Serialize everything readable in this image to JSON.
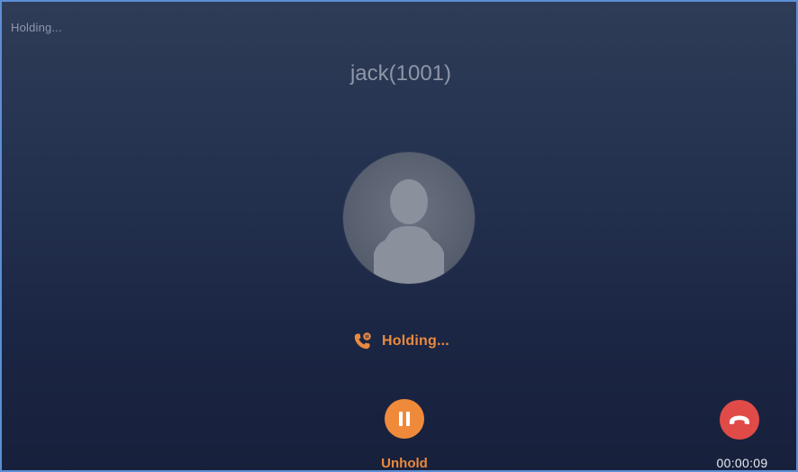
{
  "call_screen": {
    "status_top": "Holding...",
    "contact_name": "jack(1001)",
    "avatar_icon": "person-silhouette-icon",
    "hold_status": {
      "icon": "phone-hold-icon",
      "text": "Holding..."
    },
    "unhold": {
      "icon": "pause-icon",
      "label": "Unhold"
    },
    "hangup": {
      "icon": "hang-up-icon"
    },
    "timer": "00:00:09"
  },
  "colors": {
    "background_top": "#2f3c57",
    "background_bottom": "#17203b",
    "accent_orange": "#f08a3b",
    "hangup_red": "#e04b48",
    "muted_text": "#8e96a6",
    "frame_border": "#5b8fd6"
  }
}
